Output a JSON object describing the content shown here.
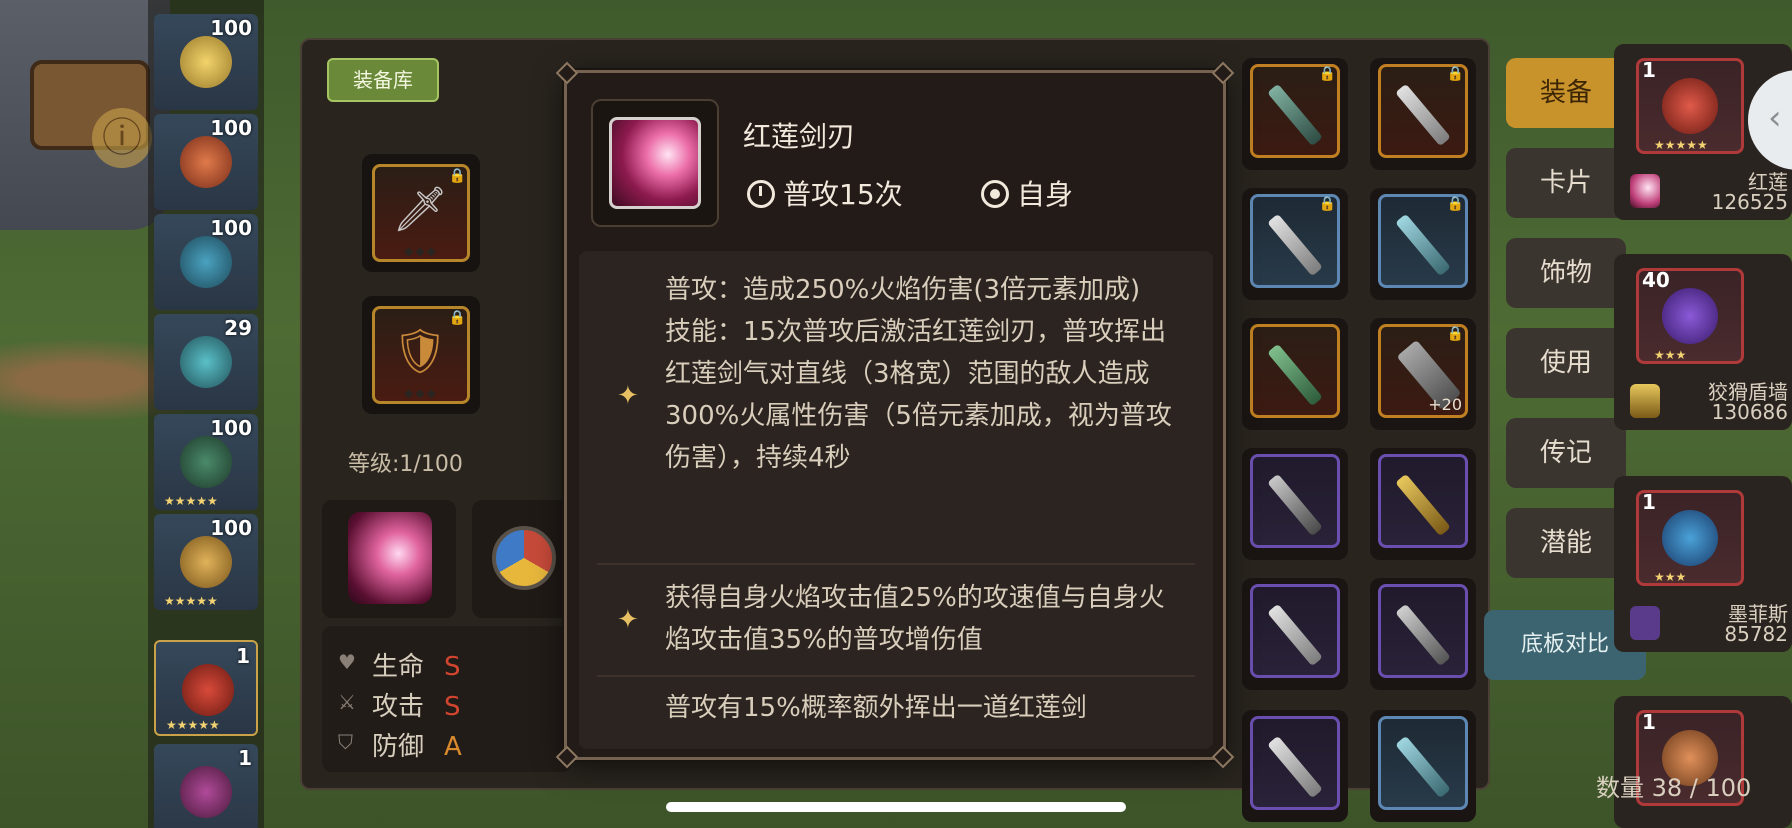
{
  "hero_strip": {
    "levels": [
      "100",
      "100",
      "100",
      "29",
      "100",
      "100",
      "1",
      "1"
    ]
  },
  "storehouse": {
    "tab_label": "装备库",
    "level_text": "等级:1/100",
    "stats": [
      {
        "label": "生命",
        "grade": "S",
        "icon": "heart-icon"
      },
      {
        "label": "攻击",
        "grade": "S",
        "icon": "sword-icon"
      },
      {
        "label": "防御",
        "grade": "A",
        "icon": "shield-icon"
      }
    ],
    "equip_plus_label": "+20",
    "side_buttons": {
      "equip": "装备",
      "card": "卡片",
      "accessory": "饰物",
      "use": "使用",
      "biography": "传记",
      "potential": "潜能",
      "compare": "底板对比"
    },
    "count_text": "数量 38 / 100"
  },
  "roster": [
    {
      "level": "1",
      "name": "红莲",
      "power": "126525",
      "color": "#b03a3a"
    },
    {
      "level": "40",
      "name": "狡猾盾墙",
      "power": "130686",
      "color": "#b03a3a"
    },
    {
      "level": "1",
      "name": "墨菲斯",
      "power": "85782",
      "color": "#b03a3a"
    },
    {
      "level": "1",
      "name": "",
      "power": "",
      "color": "#b03a3a"
    }
  ],
  "tooltip": {
    "item_name": "红莲剑刃",
    "trigger": "普攻15次",
    "target": "自身",
    "sections": [
      {
        "icon": "sparkle-icon",
        "text": "普攻：造成250%火焰伤害(3倍元素加成)\n技能：15次普攻后激活红莲剑刃，普攻挥出红莲剑气对直线（3格宽）范围的敌人造成300%火属性伤害（5倍元素加成，视为普攻伤害），持续4秒"
      },
      {
        "icon": "sparkle-icon",
        "text": "获得自身火焰攻击值25%的攻速值与自身火焰攻击值35%的普攻增伤值"
      },
      {
        "icon": "",
        "text": "普攻有15%概率额外挥出一道红莲剑"
      }
    ]
  },
  "colors": {
    "accent_gold": "#c9932c",
    "tooltip_bg": "#231b17",
    "grade_s": "#d3452e",
    "grade_a": "#d98a2d"
  }
}
